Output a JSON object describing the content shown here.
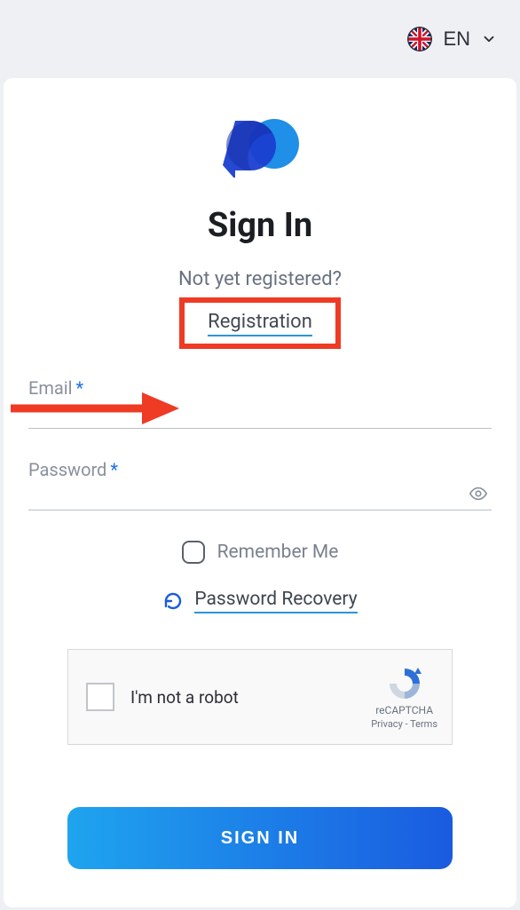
{
  "header": {
    "lang_label": "EN"
  },
  "page": {
    "title": "Sign In",
    "subtitle": "Not yet registered?",
    "registration_link": "Registration"
  },
  "fields": {
    "email_label": "Email",
    "email_value": "",
    "password_label": "Password",
    "password_value": ""
  },
  "options": {
    "remember_label": "Remember Me",
    "recovery_label": "Password Recovery"
  },
  "captcha": {
    "label": "I'm not a robot",
    "brand": "reCAPTCHA",
    "privacy": "Privacy",
    "terms": "Terms"
  },
  "actions": {
    "signin_label": "SIGN IN"
  },
  "colors": {
    "accent_blue": "#1a5be0",
    "highlight_red": "#ef3a24"
  }
}
